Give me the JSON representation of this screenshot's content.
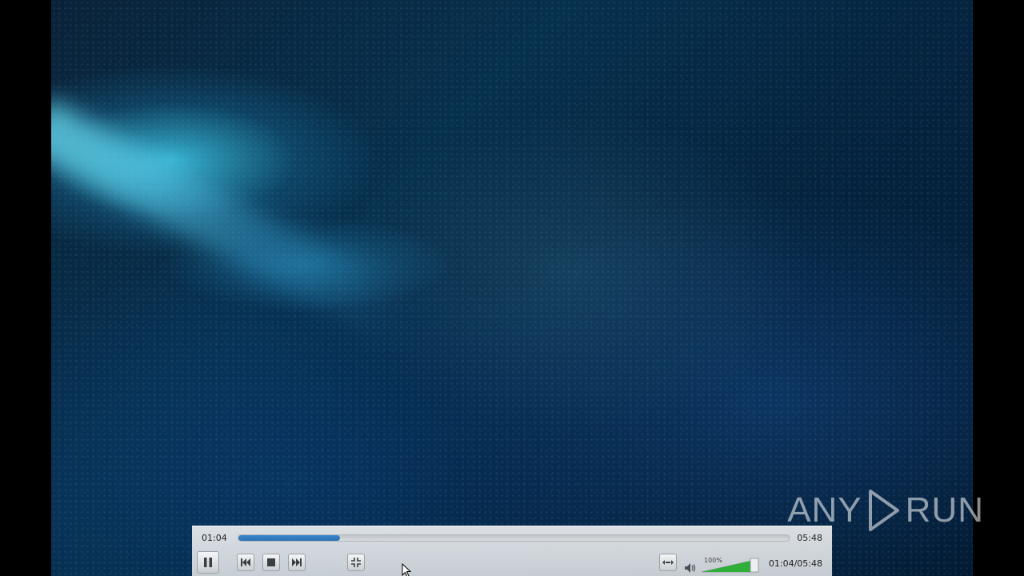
{
  "player": {
    "time_elapsed": "01:04",
    "time_duration": "05:48",
    "time_combined": "01:04/05:48",
    "progress_fraction": 0.184,
    "volume_label": "100%",
    "volume_fraction": 1.0
  },
  "controls": {
    "pause_icon": "pause-icon",
    "prev_icon": "skip-previous-icon",
    "stop_icon": "stop-icon",
    "next_icon": "skip-next-icon",
    "fullscreen_icon": "fullscreen-icon",
    "extended_icon": "extended-settings-icon",
    "volume_icon": "speaker-icon"
  },
  "watermark": {
    "text_left": "ANY",
    "text_right": "RUN"
  },
  "colors": {
    "seek_fill": "#2b73b4",
    "volume_fill": "#2fae3a"
  }
}
